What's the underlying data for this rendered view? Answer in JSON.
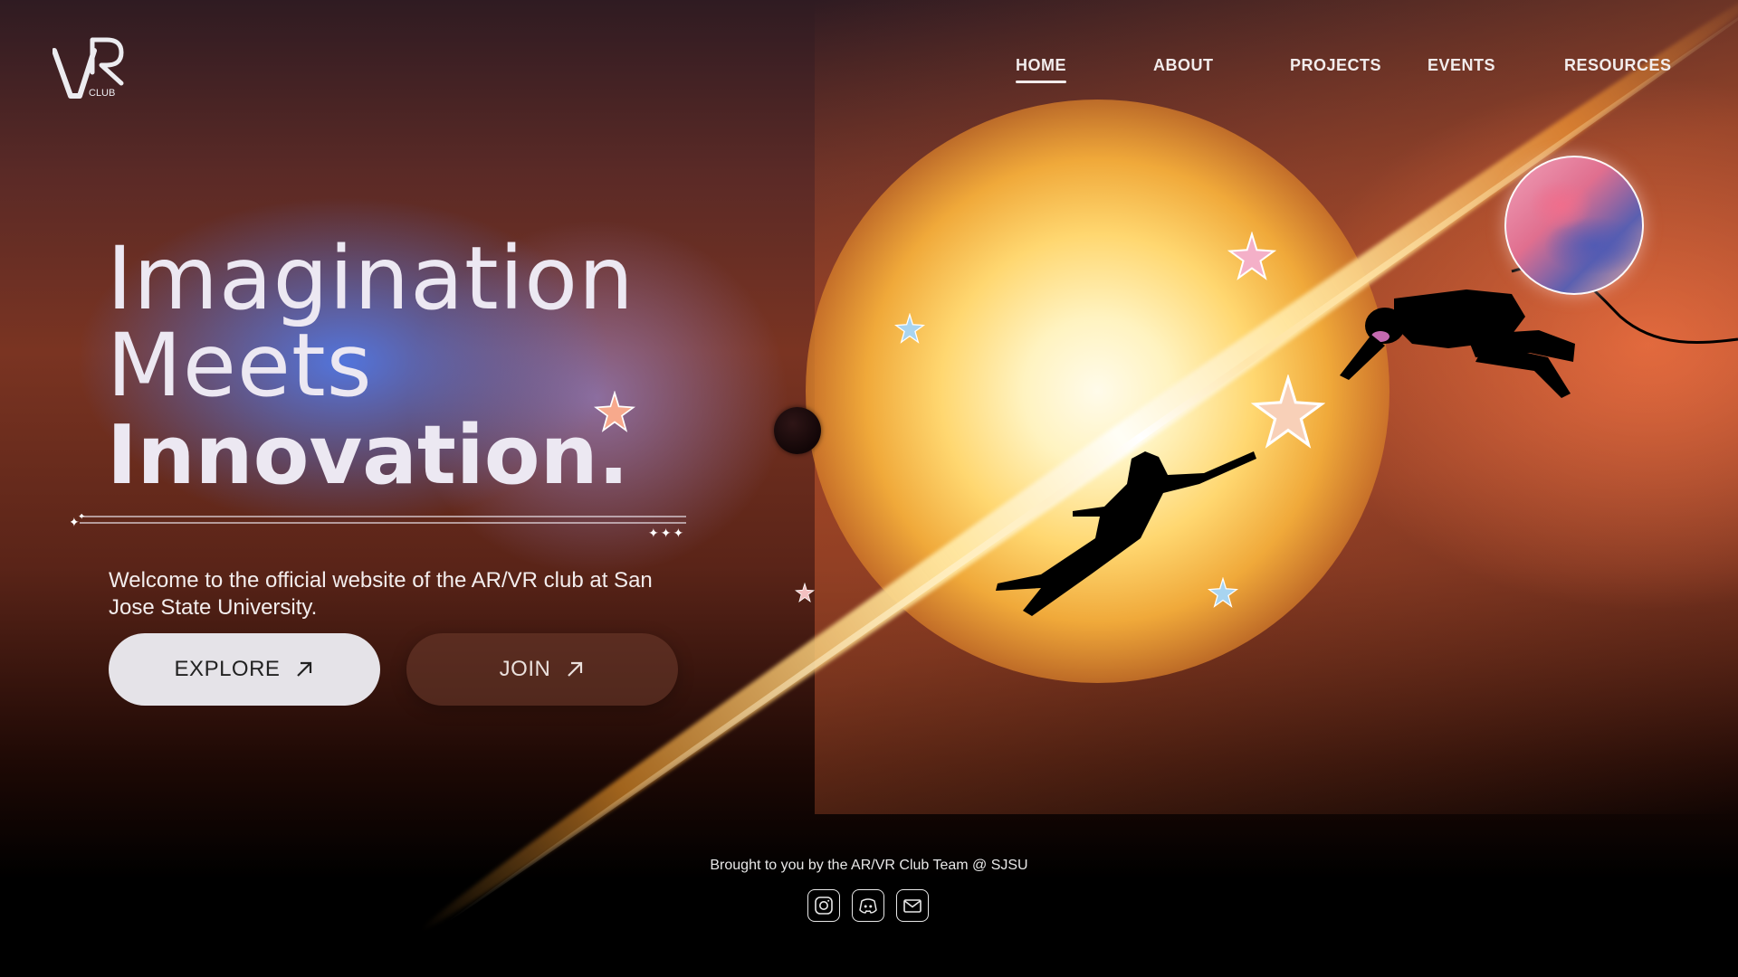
{
  "brand": {
    "logo_letters": "VR",
    "logo_sub": "CLUB"
  },
  "nav": {
    "items": [
      {
        "label": "HOME",
        "active": true
      },
      {
        "label": "ABOUT",
        "active": false
      },
      {
        "label": "PROJECTS",
        "active": false
      },
      {
        "label": "EVENTS",
        "active": false
      },
      {
        "label": "RESOURCES",
        "active": false
      }
    ]
  },
  "hero": {
    "headline_line1": "Imagination",
    "headline_line2": "Meets",
    "headline_line3": "Innovation.",
    "welcome": "Welcome to the official website of the AR/VR club at San Jose State University.",
    "explore_label": "EXPLORE",
    "join_label": "JOIN"
  },
  "footer": {
    "credit": "Brought to you by the AR/VR Club Team @ SJSU",
    "social_icons": [
      "instagram-icon",
      "discord-icon",
      "email-icon"
    ]
  },
  "colors": {
    "accent_blue": "#5078e6",
    "accent_orange": "#f07346",
    "sun_core": "#fffbea",
    "button_light": "#e5e3e8"
  }
}
